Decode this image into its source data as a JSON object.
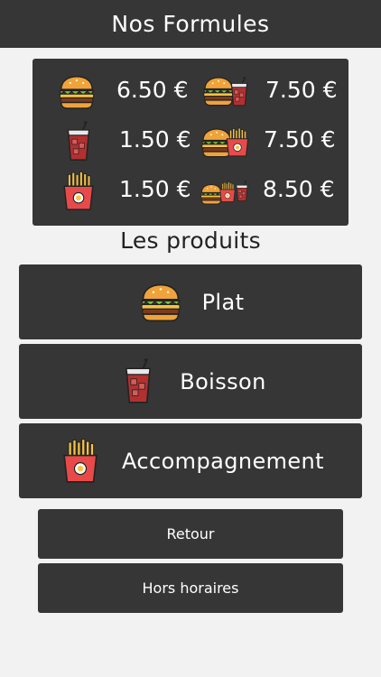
{
  "header": {
    "title": "Nos Formules"
  },
  "formules": [
    {
      "icon": "burger-icon",
      "price": "6.50 €"
    },
    {
      "icon": "burger-drink-icon",
      "price": "7.50 €"
    },
    {
      "icon": "drink-icon",
      "price": "1.50 €"
    },
    {
      "icon": "burger-fries-icon",
      "price": "7.50 €"
    },
    {
      "icon": "fries-icon",
      "price": "1.50 €"
    },
    {
      "icon": "burger-fries-drink-icon",
      "price": "8.50 €"
    }
  ],
  "products": {
    "title": "Les produits",
    "items": [
      {
        "label": "Plat",
        "icon": "burger-icon"
      },
      {
        "label": "Boisson",
        "icon": "drink-icon"
      },
      {
        "label": "Accompagnement",
        "icon": "fries-icon"
      }
    ]
  },
  "buttons": {
    "back_label": "Retour",
    "hours_label": "Hors horaires"
  },
  "colors": {
    "panel": "#363636",
    "background": "#f2f2f2",
    "bun": "#f0a33a",
    "drink": "#b33030",
    "fries_box": "#e84a4a",
    "fries": "#f6c343"
  }
}
